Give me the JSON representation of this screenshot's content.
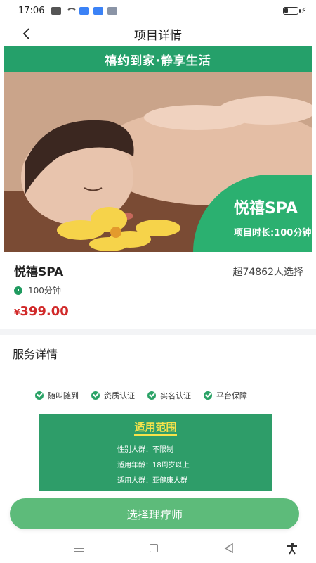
{
  "status_bar": {
    "time": "17:06"
  },
  "nav": {
    "title": "项目详情"
  },
  "banner": {
    "headline": "禧约到家·静享生活",
    "badge_title": "悦禧SPA",
    "badge_subtitle": "项目时长:100分钟"
  },
  "product": {
    "name": "悦禧SPA",
    "sold": "超74862人选择",
    "duration": "100分钟",
    "price_symbol": "¥",
    "price": "399.00"
  },
  "service": {
    "section_title": "服务详情",
    "features": [
      "随叫随到",
      "资质认证",
      "实名认证",
      "平台保障"
    ],
    "scope_title": "适用范围",
    "scope_rows": [
      "性别人群：不限制",
      "适用年龄：18周岁以上",
      "适用人群：亚健康人群"
    ]
  },
  "cta": {
    "label": "选择理疗师"
  },
  "colors": {
    "brand_green": "#2e9d69",
    "price_red": "#d12a2a",
    "cta_green": "#5dbb7a"
  }
}
